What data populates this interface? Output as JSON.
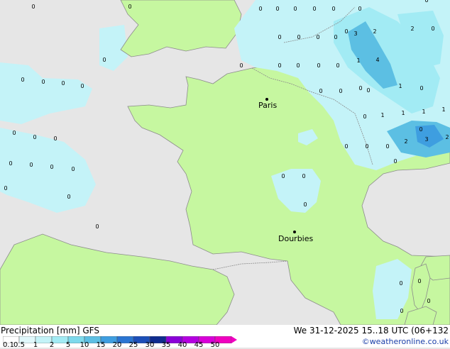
{
  "map": {
    "cities": [
      {
        "name": "Paris"
      },
      {
        "name": "Dourbies"
      }
    ],
    "markers": [
      "0",
      "0",
      "0",
      "0",
      "0",
      "0",
      "0",
      "0",
      "0",
      "0",
      "0",
      "0",
      "0",
      "0",
      "0",
      "0",
      "0",
      "0",
      "0",
      "0",
      "0",
      "0",
      "0",
      "0",
      "0",
      "0",
      "0",
      "0",
      "0",
      "0",
      "0",
      "0",
      "0",
      "0",
      "0",
      "0",
      "0",
      "0",
      "0",
      "0",
      "0",
      "0",
      "3",
      "2",
      "2",
      "1",
      "4",
      "1",
      "1",
      "1",
      "1",
      "1",
      "2",
      "3",
      "2",
      "0",
      "0",
      "0",
      "0",
      "0",
      "0",
      "0",
      "0",
      "0",
      "0",
      "0"
    ]
  },
  "legend": {
    "title": "Precipitation [mm] GFS",
    "date": "We 31-12-2025 15..18 UTC (06+132",
    "credit": "©weatheronline.co.uk",
    "scale": [
      {
        "label": "0.1",
        "color": "#ffffff"
      },
      {
        "label": "0.5",
        "color": "#e0f8fb"
      },
      {
        "label": "1",
        "color": "#c4f3f8"
      },
      {
        "label": "2",
        "color": "#a2ebf4"
      },
      {
        "label": "5",
        "color": "#7dd9ec"
      },
      {
        "label": "10",
        "color": "#5cbfe3"
      },
      {
        "label": "15",
        "color": "#3e9ee0"
      },
      {
        "label": "20",
        "color": "#2a75d2"
      },
      {
        "label": "25",
        "color": "#1c4fb8"
      },
      {
        "label": "30",
        "color": "#0f2c8e"
      },
      {
        "label": "35",
        "color": "#8a00d8"
      },
      {
        "label": "40",
        "color": "#b400e0"
      },
      {
        "label": "45",
        "color": "#d800d8"
      },
      {
        "label": "50",
        "color": "#f000c0"
      }
    ]
  },
  "colors": {
    "land": "#c6f7a0",
    "sea": "#e6e6e6",
    "coast": "#8c8c8c",
    "precip_light": "#c4f3f8",
    "precip_mid": "#a2ebf4",
    "precip_heavy": "#5cbfe3",
    "precip_core": "#3e9ee0"
  }
}
